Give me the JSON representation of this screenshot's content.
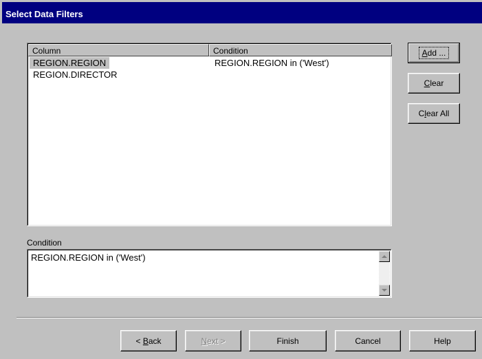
{
  "window": {
    "title": "Select Data Filters"
  },
  "filters_list": {
    "columns": [
      "Column",
      "Condition"
    ],
    "rows": [
      {
        "column": "REGION.REGION",
        "condition": "REGION.REGION in ('West')",
        "selected": true
      },
      {
        "column": "REGION.DIRECTOR",
        "condition": "",
        "selected": false
      }
    ]
  },
  "side_buttons": {
    "add": {
      "pre": "",
      "key": "A",
      "post": "dd ..."
    },
    "clear": {
      "pre": "",
      "key": "C",
      "post": "lear"
    },
    "clear_all": {
      "pre": "C",
      "key": "l",
      "post": "ear All"
    }
  },
  "condition": {
    "label": "Condition",
    "value": "REGION.REGION in ('West')"
  },
  "nav_buttons": {
    "back": {
      "pre": "< ",
      "key": "B",
      "post": "ack"
    },
    "next": {
      "pre": "",
      "key": "N",
      "post": "ext >"
    },
    "finish": "Finish",
    "cancel": "Cancel",
    "help": "Help"
  }
}
